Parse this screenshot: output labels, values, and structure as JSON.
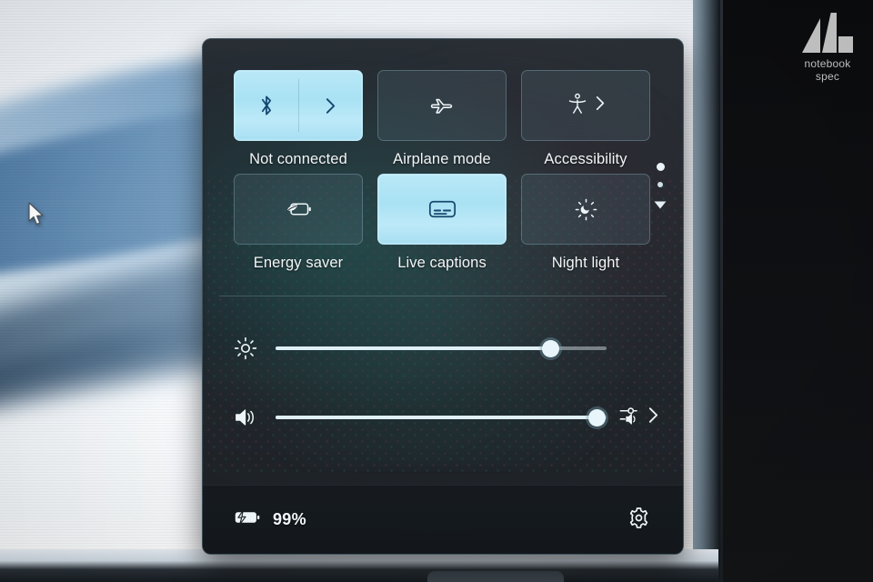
{
  "watermark": {
    "line1": "notebook",
    "line2": "spec",
    "icon": "notebookspec-logo"
  },
  "quick_settings": {
    "panel_name": "Windows Quick Settings",
    "colors": {
      "accent_on": "#a9e2f4",
      "panel_bg": "#22282e",
      "text": "#f3f6f8",
      "icon_on": "#12436b"
    },
    "tiles": [
      {
        "label": "Not connected",
        "icon": "bluetooth-icon",
        "state": "on",
        "has_chevron": true,
        "chevron_icon": "chevron-right-icon"
      },
      {
        "label": "Airplane mode",
        "icon": "airplane-icon",
        "state": "off",
        "has_chevron": false,
        "chevron_icon": ""
      },
      {
        "label": "Accessibility",
        "icon": "accessibility-icon",
        "state": "off",
        "has_chevron": true,
        "chevron_icon": "chevron-right-icon"
      },
      {
        "label": "Energy saver",
        "icon": "battery-leaf-icon",
        "state": "off",
        "has_chevron": false,
        "chevron_icon": ""
      },
      {
        "label": "Live captions",
        "icon": "live-captions-icon",
        "state": "on",
        "has_chevron": false,
        "chevron_icon": ""
      },
      {
        "label": "Night light",
        "icon": "night-light-icon",
        "state": "off",
        "has_chevron": false,
        "chevron_icon": ""
      }
    ],
    "pager": {
      "active_page": 1,
      "total_pages": 2,
      "expand_icon": "caret-down-icon"
    },
    "sliders": [
      {
        "name": "brightness",
        "icon": "brightness-icon",
        "value": 83,
        "min": 0,
        "max": 100
      },
      {
        "name": "volume",
        "icon": "volume-icon",
        "value": 97,
        "min": 0,
        "max": 100,
        "trailing_icon": "audio-output-picker-icon",
        "trailing_chevron": "chevron-right-icon"
      }
    ],
    "footer": {
      "battery_icon": "battery-charging-icon",
      "battery_percent": "99%",
      "settings_icon": "gear-icon"
    }
  },
  "desktop": {
    "cursor_icon": "mouse-pointer-icon",
    "wallpaper": "windows-bloom-wallpaper"
  }
}
